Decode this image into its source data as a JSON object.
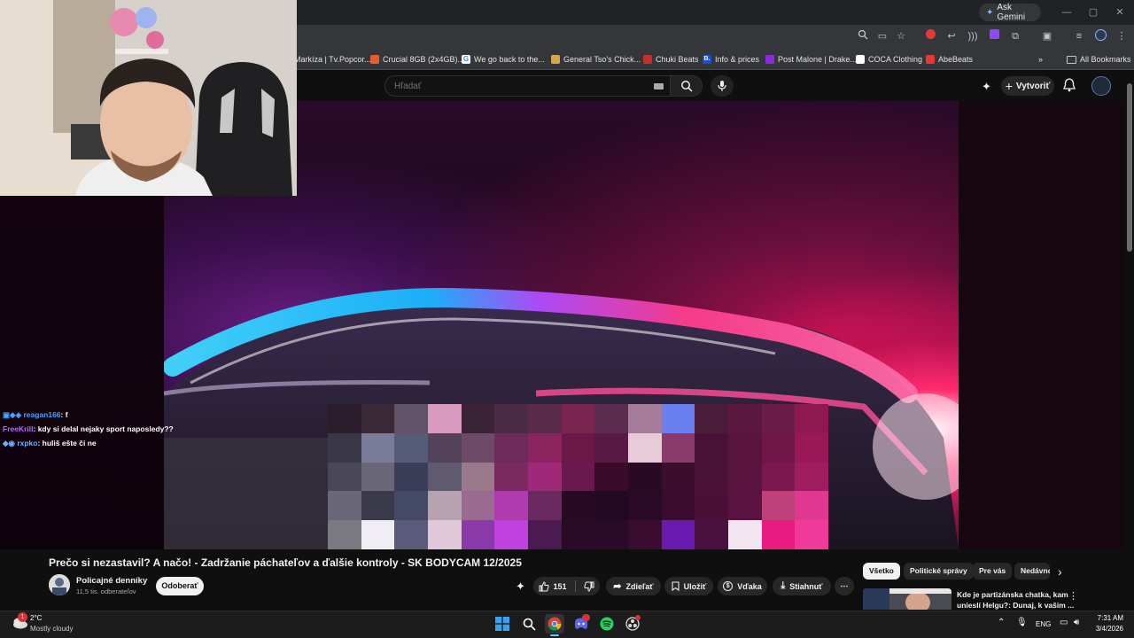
{
  "browser": {
    "ask_gemini": "Ask Gemini",
    "bookmarks": [
      {
        "label": "Markíza | Tv.Popcor...",
        "color": "#1c5bb5"
      },
      {
        "label": "Crucial 8GB (2x4GB)...",
        "color": "#e85d2a"
      },
      {
        "label": "We go back to the...",
        "color": "#4285f4"
      },
      {
        "label": "General Tso's Chick...",
        "color": "#d4a84a"
      },
      {
        "label": "Chuki Beats",
        "color": "#c4302b"
      },
      {
        "label": "Info & prices",
        "color": "#1a4fd8"
      },
      {
        "label": "Post Malone | Drake...",
        "color": "#8a2be2"
      },
      {
        "label": "COCA Clothing",
        "color": "#ffffff"
      },
      {
        "label": "AbeBeats",
        "color": "#e53935"
      }
    ],
    "all_bookmarks": "All Bookmarks"
  },
  "youtube": {
    "search_placeholder": "Hľadať",
    "create_label": "Vytvoriť",
    "video_title": "Prečo si nezastavil? A načo! - Zadržanie páchateľov a ďalšie kontroly - SK BODYCAM 12/2025",
    "channel_name": "Policajné denníky",
    "channel_subs": "11,5 tis. odberateľov",
    "subscribe_label": "Odoberať",
    "like_count": "151",
    "share_label": "Zdieľať",
    "save_label": "Uložiť",
    "thanks_label": "Vďaka",
    "download_label": "Stiahnuť",
    "chips": [
      "Všetko",
      "Politické správy",
      "Pre vás",
      "Nedávno"
    ],
    "recommended_title_line1": "Kde je partizánska chatka, kam",
    "recommended_title_line2": "unieslí Helgu?: Dunaj, k vašim ..."
  },
  "chat": [
    {
      "user": "reagan166",
      "message": ": f",
      "color": "#4aa3ff"
    },
    {
      "user": "FreeKrill",
      "message": ": kdy si delal nejaky sport naposledy??",
      "color": "#b36bff"
    },
    {
      "user": "rxpko",
      "message": ": huliš ešte či ne",
      "color": "#6cb0ff"
    }
  ],
  "taskbar": {
    "weather_temp": "2°C",
    "weather_desc": "Mostly cloudy",
    "weather_badge": "1",
    "language": "ENG",
    "time": "7:31 AM",
    "date": "3/4/2026"
  },
  "colors": {
    "youtube_bg": "#0f0f0f",
    "accent_red": "#ff0000"
  }
}
